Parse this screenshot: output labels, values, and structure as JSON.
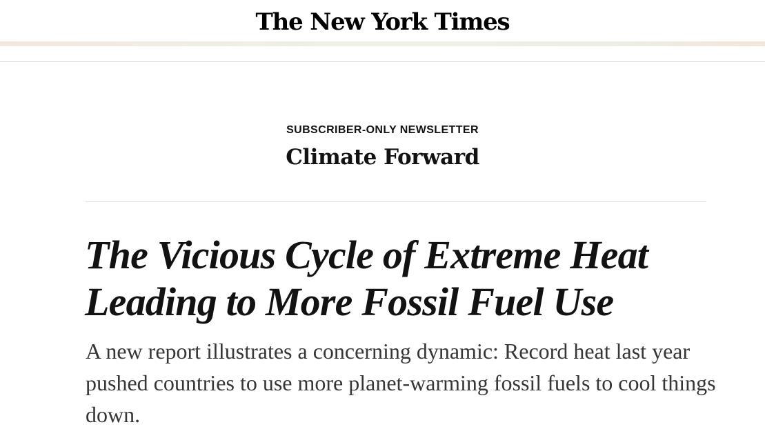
{
  "masthead": {
    "logo_text": "The New York Times"
  },
  "newsletter": {
    "kicker": "SUBSCRIBER-ONLY NEWSLETTER",
    "name": "Climate Forward"
  },
  "article": {
    "headline": "The Vicious Cycle of Extreme Heat Leading to More Fossil Fuel Use",
    "summary": "A new report illustrates a concerning dynamic: Record heat last year pushed countries to use more planet-warming fossil fuels to cool things down."
  }
}
